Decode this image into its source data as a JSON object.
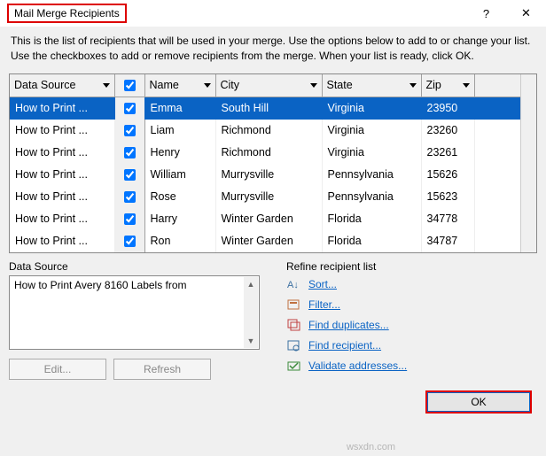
{
  "titlebar": {
    "title": "Mail Merge Recipients",
    "help": "?",
    "close": "✕"
  },
  "description": "This is the list of recipients that will be used in your merge.  Use the options below to add to or change your list.  Use the checkboxes to add or remove recipients from the merge.  When your list is ready, click OK.",
  "table": {
    "headers": {
      "dataSource": "Data Source",
      "name": "Name",
      "city": "City",
      "state": "State",
      "zip": "Zip"
    },
    "rows": [
      {
        "ds": "How to Print ...",
        "name": "Emma",
        "city": "South Hill",
        "state": "Virginia",
        "zip": "23950",
        "selected": true
      },
      {
        "ds": "How to Print ...",
        "name": "Liam",
        "city": "Richmond",
        "state": "Virginia",
        "zip": "23260",
        "selected": false
      },
      {
        "ds": "How to Print ...",
        "name": "Henry",
        "city": "Richmond",
        "state": "Virginia",
        "zip": "23261",
        "selected": false
      },
      {
        "ds": "How to Print ...",
        "name": "William",
        "city": "Murrysville",
        "state": "Pennsylvania",
        "zip": "15626",
        "selected": false
      },
      {
        "ds": "How to Print ...",
        "name": "Rose",
        "city": "Murrysville",
        "state": "Pennsylvania",
        "zip": "15623",
        "selected": false
      },
      {
        "ds": "How to Print ...",
        "name": "Harry",
        "city": "Winter Garden",
        "state": "Florida",
        "zip": "34778",
        "selected": false
      },
      {
        "ds": "How to Print ...",
        "name": "Ron",
        "city": "Winter Garden",
        "state": "Florida",
        "zip": "34787",
        "selected": false
      }
    ]
  },
  "dataSource": {
    "legend": "Data Source",
    "item": "How to Print Avery 8160 Labels from",
    "editBtn": "Edit...",
    "refreshBtn": "Refresh"
  },
  "refine": {
    "legend": "Refine recipient list",
    "sort": "Sort...",
    "filter": "Filter...",
    "duplicates": "Find duplicates...",
    "recipient": "Find recipient...",
    "validate": "Validate addresses..."
  },
  "okBtn": "OK",
  "watermark": "wsxdn.com"
}
